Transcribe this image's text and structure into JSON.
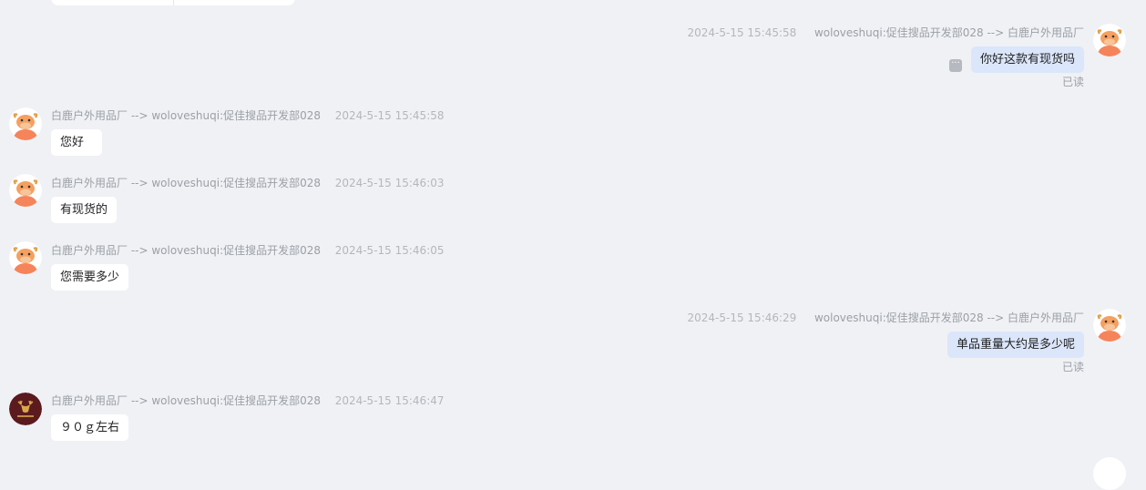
{
  "messages": [
    {
      "id": "m1",
      "direction": "out",
      "time": "2024-5-15 15:45:58",
      "route": "woloveshuqi:促佳搜品开发部028 --> 白鹿户外用品厂",
      "text": "你好这款有现货吗",
      "status": "已读",
      "avatar": "bull-avatar-icon"
    },
    {
      "id": "m2",
      "direction": "in",
      "time": "2024-5-15 15:45:58",
      "route": "白鹿户外用品厂 --> woloveshuqi:促佳搜品开发部028",
      "text": "您好",
      "avatar": "bull-avatar-icon"
    },
    {
      "id": "m3",
      "direction": "in",
      "time": "2024-5-15 15:46:03",
      "route": "白鹿户外用品厂 --> woloveshuqi:促佳搜品开发部028",
      "text": "有现货的",
      "avatar": "bull-avatar-icon"
    },
    {
      "id": "m4",
      "direction": "in",
      "time": "2024-5-15 15:46:05",
      "route": "白鹿户外用品厂 --> woloveshuqi:促佳搜品开发部028",
      "text": "您需要多少",
      "avatar": "bull-avatar-icon"
    },
    {
      "id": "m5",
      "direction": "out",
      "time": "2024-5-15 15:46:29",
      "route": "woloveshuqi:促佳搜品开发部028 --> 白鹿户外用品厂",
      "text": "单品重量大约是多少呢",
      "status": "已读",
      "avatar": "bull-avatar-icon"
    },
    {
      "id": "m6",
      "direction": "in",
      "time": "2024-5-15 15:46:47",
      "route": "白鹿户外用品厂 --> woloveshuqi:促佳搜品开发部028",
      "text": "９０ｇ左右",
      "avatar": "deer-logo-avatar-icon"
    }
  ],
  "colors": {
    "background": "#f0f1f5",
    "incoming_bubble": "#ffffff",
    "outgoing_bubble": "#dbe6fb",
    "meta_text": "#9aa0a6",
    "bull_avatar_body": "#f5845a",
    "deer_avatar_bg": "#5a1a1e"
  }
}
